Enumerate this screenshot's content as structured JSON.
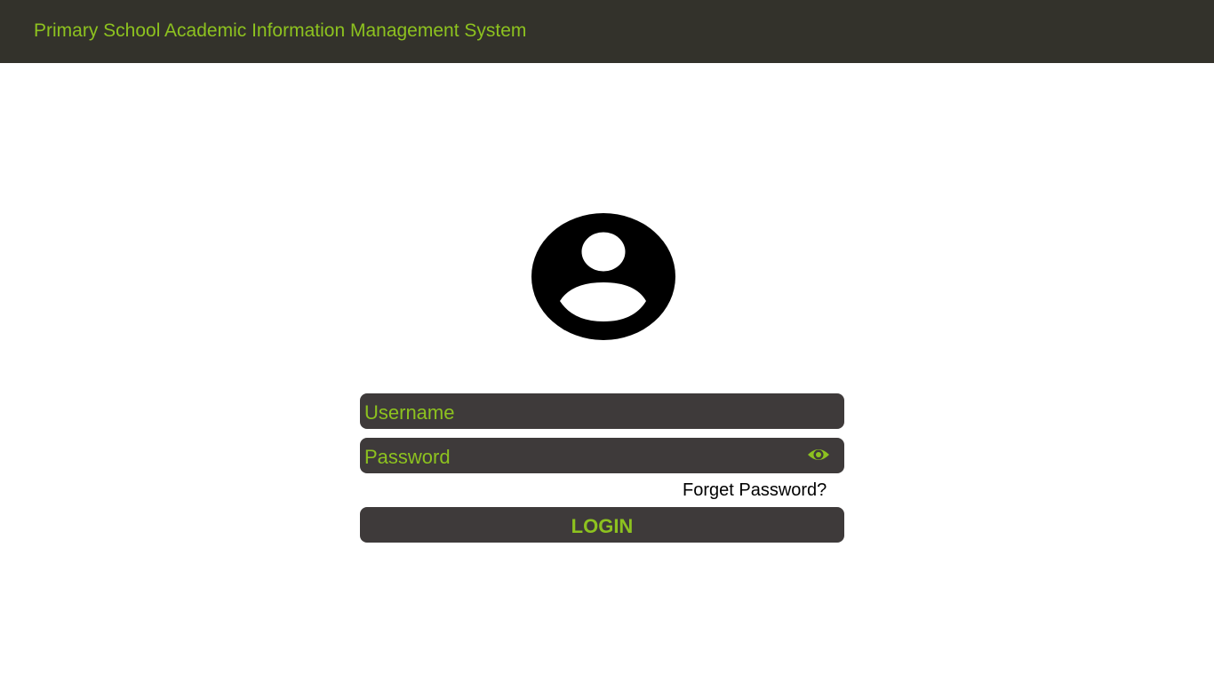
{
  "header": {
    "title": "Primary School Academic Information Management System"
  },
  "avatar": {
    "icon": "user-avatar-icon"
  },
  "form": {
    "username_placeholder": "Username",
    "password_placeholder": "Password",
    "password_toggle_icon": "eye-icon",
    "forgot_password_label": "Forget Password?",
    "login_label": "LOGIN"
  },
  "colors": {
    "header_bg": "#33322b",
    "accent": "#8dc21f",
    "field_bg": "#3e3a3a",
    "page_bg": "#ffffff"
  }
}
